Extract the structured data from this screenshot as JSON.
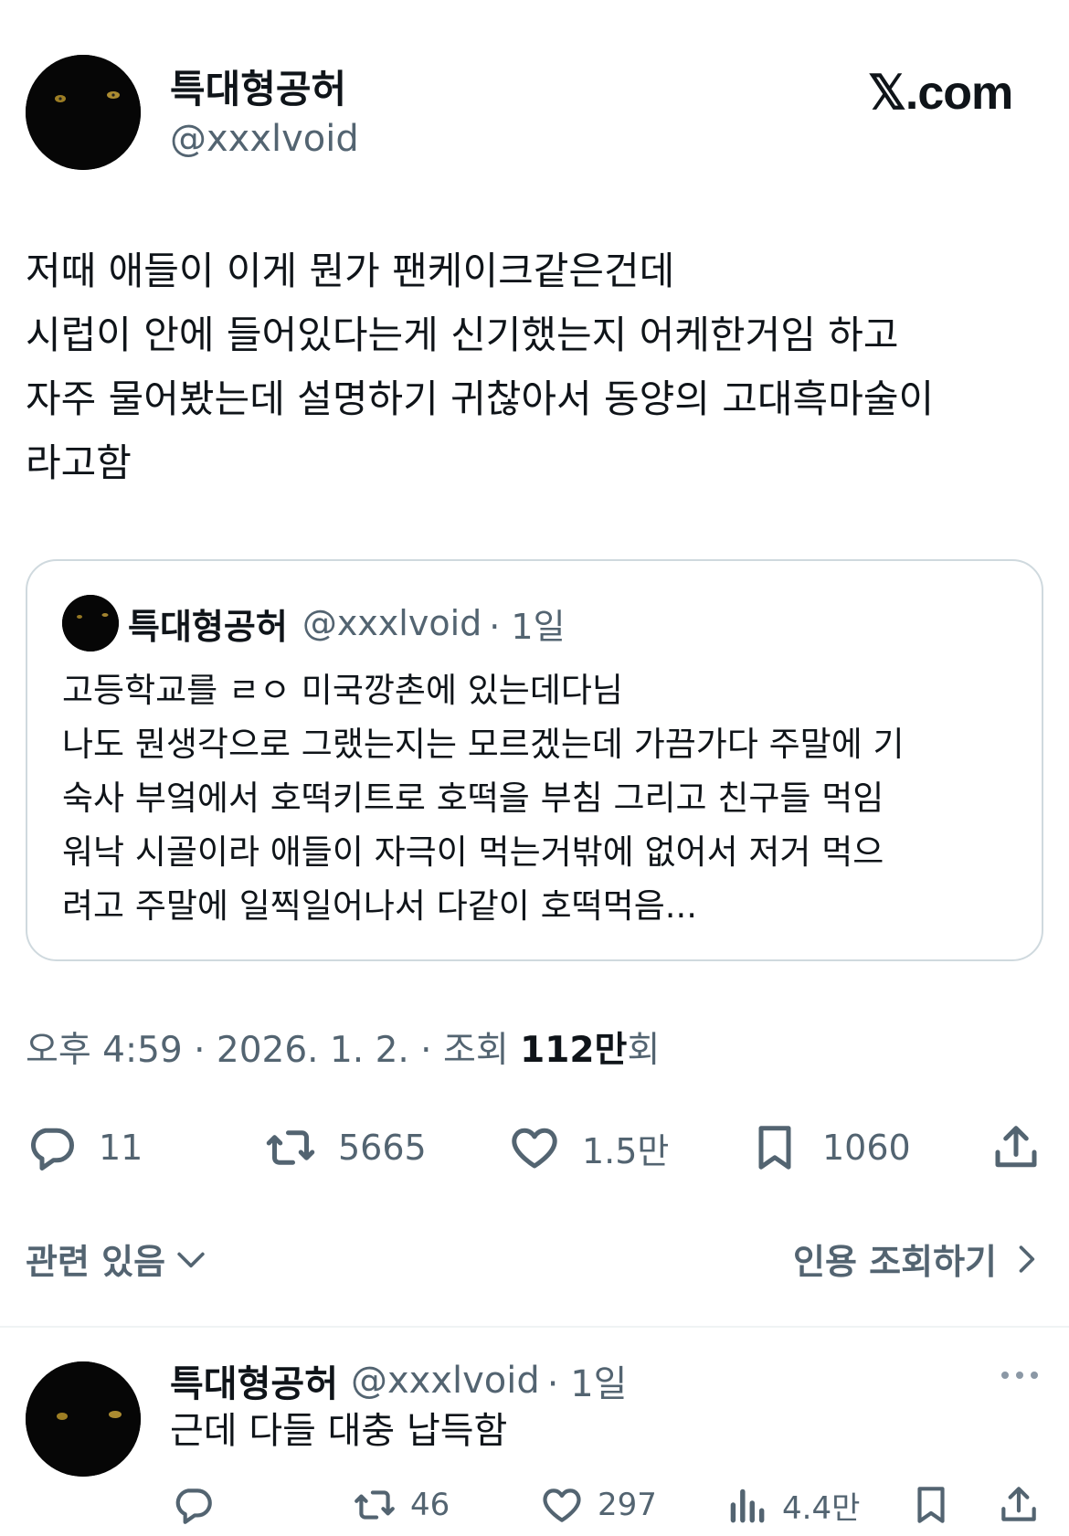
{
  "author": {
    "name": "특대형공허",
    "handle": "@xxxlvoid"
  },
  "brand": {
    "logo_text": "𝕏.com"
  },
  "tweet": {
    "text": "저때 애들이 이게 뭔가 팬케이크같은건데\n시럽이 안에 들어있다는게 신기했는지 어케한거임 하고\n자주 물어봤는데 설명하기 귀찮아서 동양의 고대흑마술이\n라고함"
  },
  "quote": {
    "name": "특대형공허",
    "handle": "@xxxlvoid",
    "time": "· 1일",
    "text": "고등학교를 ㄹㅇ 미국깡촌에 있는데다님\n나도 뭔생각으로 그랬는지는 모르겠는데 가끔가다 주말에 기\n숙사 부엌에서 호떡키트로 호떡을 부침 그리고 친구들 먹임\n워낙 시골이라 애들이 자극이 먹는거밖에 없어서 저거 먹으\n려고 주말에 일찍일어나서 다같이 호떡먹음..."
  },
  "meta": {
    "timestamp": "오후 4:59 · 2026. 1. 2. · 조회 ",
    "views": "112만",
    "views_suffix": "회"
  },
  "actions": {
    "replies": "11",
    "reposts": "5665",
    "likes": "1.5만",
    "bookmarks": "1060"
  },
  "related": {
    "label": "관련 있음",
    "quotes_link": "인용 조회하기"
  },
  "reply": {
    "name": "특대형공허",
    "handle": "@xxxlvoid",
    "time": "· 1일",
    "text": "근데 다들 대충 납득함",
    "replies": "",
    "reposts": "46",
    "likes": "297",
    "views": "4.4만"
  },
  "colors": {
    "text": "#0f1419",
    "secondary": "#536471",
    "border": "#cfd9de",
    "divider": "#eff3f4"
  },
  "icons": [
    "reply-icon",
    "repost-icon",
    "like-icon",
    "bookmark-icon",
    "share-icon",
    "views-icon",
    "more-icon",
    "chevron-down-icon",
    "chevron-right-icon"
  ]
}
